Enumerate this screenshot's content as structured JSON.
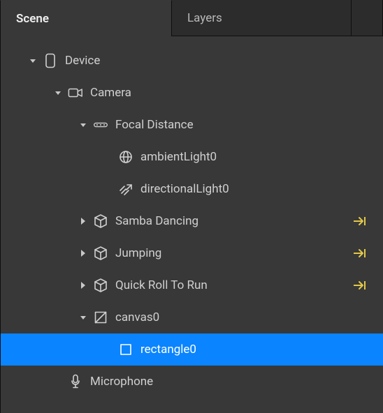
{
  "tabs": {
    "scene": "Scene",
    "layers": "Layers",
    "active": "scene"
  },
  "tree": [
    {
      "id": "device",
      "depth": 0,
      "expand": "open",
      "icon": "device",
      "label": "Device",
      "trail": null,
      "selected": false
    },
    {
      "id": "camera",
      "depth": 1,
      "expand": "open",
      "icon": "camera",
      "label": "Camera",
      "trail": null,
      "selected": false
    },
    {
      "id": "focal-distance",
      "depth": 2,
      "expand": "open",
      "icon": "focal",
      "label": "Focal Distance",
      "trail": null,
      "selected": false
    },
    {
      "id": "ambient-light0",
      "depth": 3,
      "expand": "none",
      "icon": "globe",
      "label": "ambientLight0",
      "trail": null,
      "selected": false
    },
    {
      "id": "directional-light0",
      "depth": 3,
      "expand": "none",
      "icon": "directional",
      "label": "directionalLight0",
      "trail": null,
      "selected": false
    },
    {
      "id": "samba-dancing",
      "depth": 2,
      "expand": "closed",
      "icon": "cube",
      "label": "Samba Dancing",
      "trail": "arrow",
      "selected": false
    },
    {
      "id": "jumping",
      "depth": 2,
      "expand": "closed",
      "icon": "cube",
      "label": "Jumping",
      "trail": "arrow",
      "selected": false
    },
    {
      "id": "quick-roll-to-run",
      "depth": 2,
      "expand": "closed",
      "icon": "cube",
      "label": "Quick Roll To Run",
      "trail": "arrow",
      "selected": false
    },
    {
      "id": "canvas0",
      "depth": 2,
      "expand": "open",
      "icon": "canvas",
      "label": "canvas0",
      "trail": null,
      "selected": false
    },
    {
      "id": "rectangle0",
      "depth": 3,
      "expand": "none",
      "icon": "rectangle",
      "label": "rectangle0",
      "trail": null,
      "selected": true
    },
    {
      "id": "microphone",
      "depth": 1,
      "expand": "none",
      "icon": "mic",
      "label": "Microphone",
      "trail": null,
      "selected": false
    }
  ],
  "indent": {
    "base": 36,
    "step": 36
  }
}
